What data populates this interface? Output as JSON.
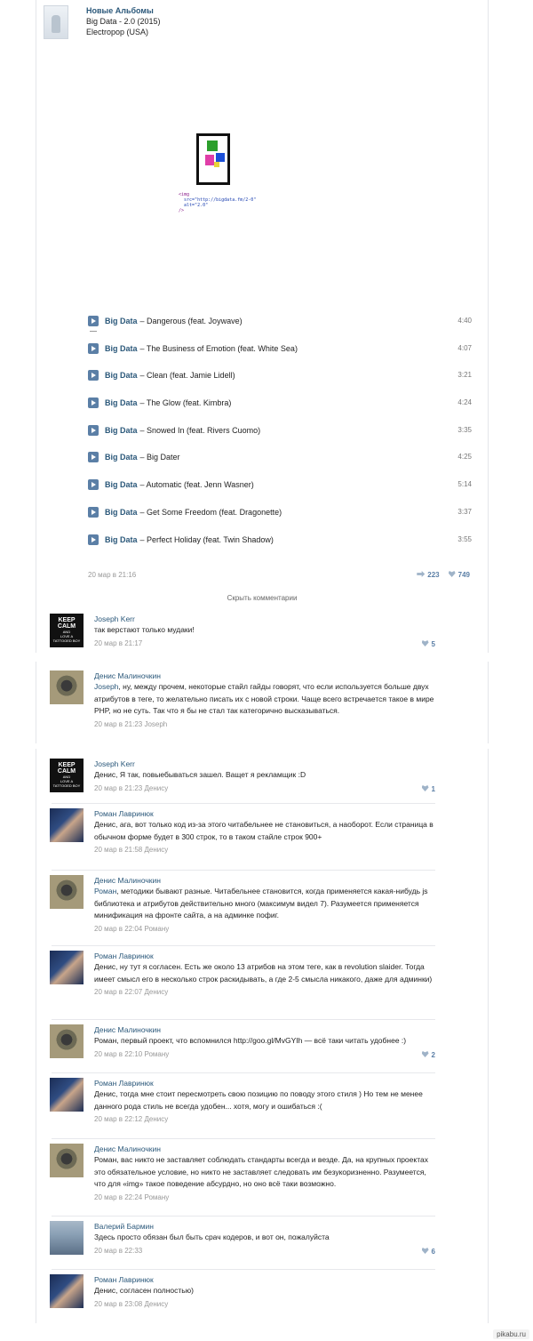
{
  "post": {
    "author": "Новые Альбомы",
    "album_line": "Big Data - 2.0 (2015)",
    "genre_line": "Electropop (USA)",
    "code_lines": [
      "<img",
      "  src=\"http://bigdata.fm/2-0\"",
      "  alt=\"2.0\"",
      "/>"
    ],
    "tracks": [
      {
        "artist": "Big Data",
        "title": "– Dangerous (feat. Joywave)",
        "duration": "4:40"
      },
      {
        "artist": "Big Data",
        "title": "– The Business of Emotion (feat. White Sea)",
        "duration": "4:07"
      },
      {
        "artist": "Big Data",
        "title": "– Clean (feat. Jamie Lidell)",
        "duration": "3:21"
      },
      {
        "artist": "Big Data",
        "title": "– The Glow (feat. Kimbra)",
        "duration": "4:24"
      },
      {
        "artist": "Big Data",
        "title": "– Snowed In (feat. Rivers Cuomo)",
        "duration": "3:35"
      },
      {
        "artist": "Big Data",
        "title": "– Big Dater",
        "duration": "4:25"
      },
      {
        "artist": "Big Data",
        "title": "– Automatic (feat. Jenn Wasner)",
        "duration": "5:14"
      },
      {
        "artist": "Big Data",
        "title": "– Get Some Freedom (feat. Dragonette)",
        "duration": "3:37"
      },
      {
        "artist": "Big Data",
        "title": "– Perfect Holiday (feat. Twin Shadow)",
        "duration": "3:55"
      }
    ],
    "date": "20 мар в 21:16",
    "reposts": "223",
    "likes": "749",
    "hide_comments": "Скрыть комментарии"
  },
  "avatar_text": {
    "keep": "KEEP",
    "calm": "CALM",
    "and": "AND",
    "love": "LOVE A",
    "boy": "TATTOOED BOY"
  },
  "comments": [
    {
      "author": "Joseph Kerr",
      "mention": "",
      "text": "так верстают только мудаки!",
      "date": "20 мар в 21:17",
      "likes": "5"
    },
    {
      "author": "Денис Малиночкин",
      "mention": "Joseph",
      "text": ", ну, между прочем, некоторые стайл гайды говорят, что если используется больше двух атрибутов в теге, то желательно писать их с новой строки. Чаще всего встречается такое в мире PHP, но не суть. Так что я бы не стал так категорично высказываться.",
      "date": "20 мар в 21:23 Joseph",
      "likes": ""
    },
    {
      "author": "Joseph Kerr",
      "mention": "",
      "text": "Денис, Я так, повыебываться зашел. Ващет я рекламщик :D",
      "date": "20 мар в 21:23 Денису",
      "likes": "1"
    },
    {
      "author": "Роман Лавринюк",
      "mention": "",
      "text": "Денис, ага, вот только код из-за этого читабельнее не становиться, а наоборот. Если страница в обычном форме будет в 300 строк, то в таком стайле строк 900+",
      "date": "20 мар в 21:58 Денису",
      "likes": ""
    },
    {
      "author": "Денис Малиночкин",
      "mention": "Роман",
      "text": ", методики бывают разные. Читабельнее становится, когда применяется какая-нибудь js библиотека и атрибутов действительно много (максимум видел 7). Разумеется применяется минификация на фронте сайта, а на админке пофиг.",
      "date": "20 мар в 22:04 Роману",
      "likes": ""
    },
    {
      "author": "Роман Лавринюк",
      "mention": "",
      "text": "Денис, ну тут я согласен. Есть же около 13 атрибов на этом теге, как в revolution slaider. Тогда имеет смысл его в несколько строк раскидывать, а где 2-5 смысла никакого, даже для админки)",
      "date": "20 мар в 22:07 Денису",
      "likes": ""
    },
    {
      "author": "Денис Малиночкин",
      "mention": "",
      "text": "Роман, первый проект, что вспомнился http://goo.gl/MvGYIh — всё таки читать удобнее :)",
      "date": "20 мар в 22:10 Роману",
      "likes": "2"
    },
    {
      "author": "Роман Лавринюк",
      "mention": "",
      "text": "Денис, тогда мне стоит пересмотреть свою позицию по поводу этого стиля ) Но тем не менее данного рода стиль не всегда удобен... хотя, могу и ошибаться :(",
      "date": "20 мар в 22:12 Денису",
      "likes": ""
    },
    {
      "author": "Денис Малиночкин",
      "mention": "",
      "text": "Роман, вас никто не заставляет соблюдать стандарты всегда и везде. Да, на крупных проектах это обязательное условие, но никто не заставляет следовать им безукоризненно. Разумеется, что для «img» такое поведение абсурдно, но оно всё таки возможно.",
      "date": "20 мар в 22:24 Роману",
      "likes": ""
    },
    {
      "author": "Валерий Бармин",
      "mention": "",
      "text": "Здесь просто обязан был быть срач кодеров, и вот он, пожалуйста",
      "date": "20 мар в 22:33",
      "likes": "6"
    },
    {
      "author": "Роман Лавринюк",
      "mention": "",
      "text": "Денис, согласен полностью)",
      "date": "20 мар в 23:08 Денису",
      "likes": ""
    }
  ],
  "watermark": "pikabu.ru"
}
